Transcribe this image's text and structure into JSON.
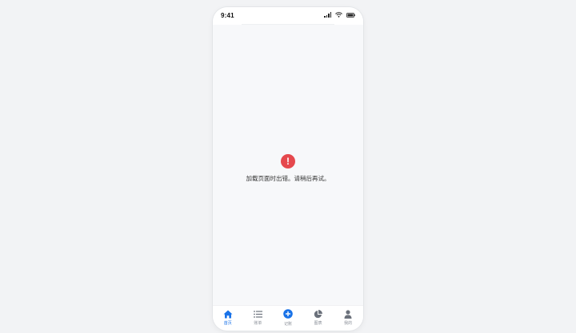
{
  "status_bar": {
    "time": "9:41",
    "icons": [
      "signal-icon",
      "wifi-icon",
      "battery-icon"
    ]
  },
  "error": {
    "icon": "error-icon",
    "message": "加载页面时出错。请稍后再试。",
    "color": "#e5484d"
  },
  "tab_bar": {
    "accent_color": "#1a73e8",
    "items": [
      {
        "label": "首页",
        "icon": "home-icon",
        "active": true
      },
      {
        "label": "账单",
        "icon": "list-icon",
        "active": false
      },
      {
        "label": "记账",
        "icon": "plus-circle-icon",
        "active": false
      },
      {
        "label": "图表",
        "icon": "pie-chart-icon",
        "active": false
      },
      {
        "label": "我的",
        "icon": "user-icon",
        "active": false
      }
    ]
  }
}
